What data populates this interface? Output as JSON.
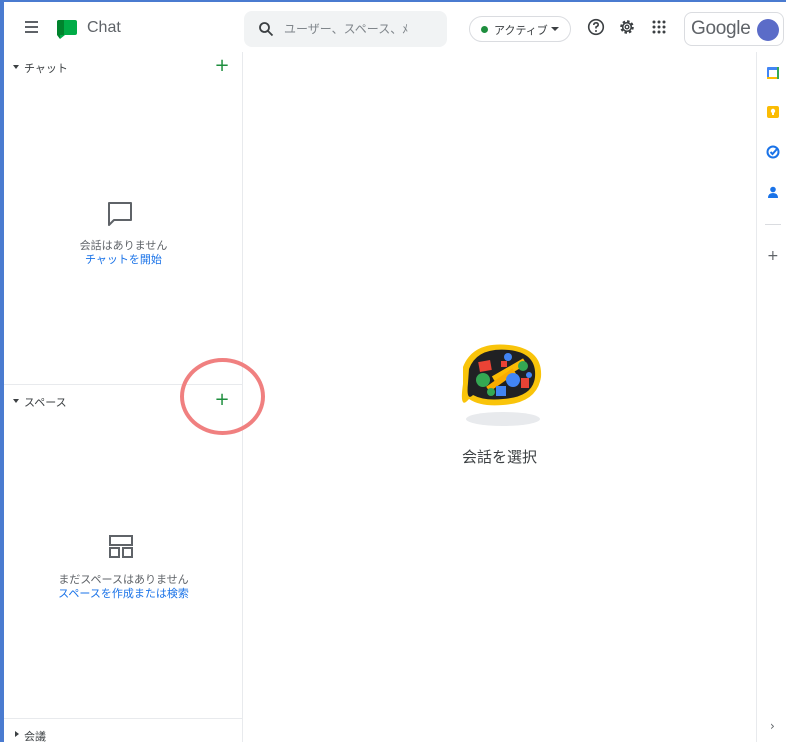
{
  "app": {
    "title": "Chat"
  },
  "search": {
    "placeholder": "ユーザー、スペース、ﾒ"
  },
  "status": {
    "label": "アクティブ",
    "color": "#1e8e3e"
  },
  "account": {
    "label": "Google"
  },
  "sidebar": {
    "chat": {
      "title": "チャット",
      "empty_text": "会話はありません",
      "empty_link": "チャットを開始"
    },
    "spaces": {
      "title": "スペース",
      "empty_text": "まだスペースはありません",
      "empty_link": "スペースを作成または検索"
    },
    "meetings": {
      "title": "会議"
    }
  },
  "main": {
    "caption": "会話を選択"
  },
  "icons": {
    "menu": "hamburger-menu-icon",
    "search": "search-icon",
    "help": "help-icon",
    "settings": "settings-icon",
    "apps": "apps-grid-icon",
    "rail": [
      "calendar-icon",
      "keep-icon",
      "tasks-icon",
      "contacts-icon"
    ]
  },
  "colors": {
    "accent_green": "#1e8e3e",
    "link_blue": "#1a73e8",
    "annotation": "#f08080"
  }
}
